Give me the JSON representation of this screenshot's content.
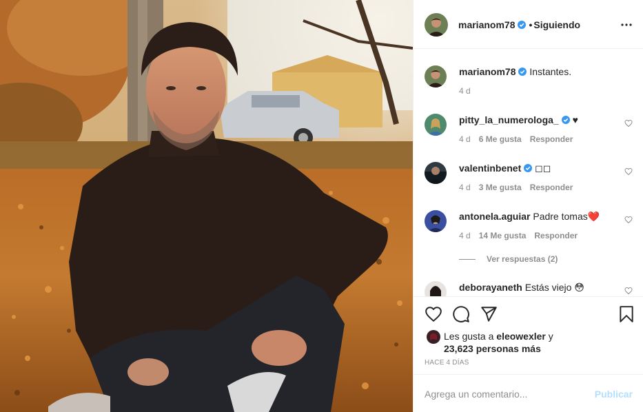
{
  "post": {
    "author": "marianom78",
    "follow_status": "Siguiendo",
    "separator": "•"
  },
  "caption": {
    "username": "marianom78",
    "text": "Instantes.",
    "time": "4 d"
  },
  "comments": [
    {
      "username": "pitty_la_numerologa_",
      "verified": true,
      "text": "♥",
      "time": "4 d",
      "likes": "6 Me gusta",
      "reply": "Responder"
    },
    {
      "username": "valentinbenet",
      "verified": true,
      "text": "◻◻",
      "time": "4 d",
      "likes": "3 Me gusta",
      "reply": "Responder"
    },
    {
      "username": "antonela.aguiar",
      "verified": false,
      "text": "Padre tomas❤️",
      "time": "4 d",
      "likes": "14 Me gusta",
      "reply": "Responder",
      "view_replies": "Ver respuestas (2)"
    },
    {
      "username": "deborayaneth",
      "verified": false,
      "text": "Estás viejo 😳"
    }
  ],
  "likes": {
    "prefix": "Les gusta a",
    "user": "eleowexler",
    "conjunction": "y",
    "others": "23,623 personas más"
  },
  "timestamp": "Hace 4 días",
  "comment_box": {
    "placeholder": "Agrega un comentario...",
    "publish_label": "Publicar"
  },
  "icons": {
    "verified": "verified-badge-icon",
    "more": "more-options-icon",
    "like": "heart-icon",
    "comment": "comment-icon",
    "share": "share-icon",
    "save": "bookmark-icon"
  },
  "colors": {
    "verified_blue": "#3897f0",
    "muted_text": "#8e8e8e",
    "publish_disabled": "#b2dffc",
    "heart_red": "#ed4956"
  }
}
